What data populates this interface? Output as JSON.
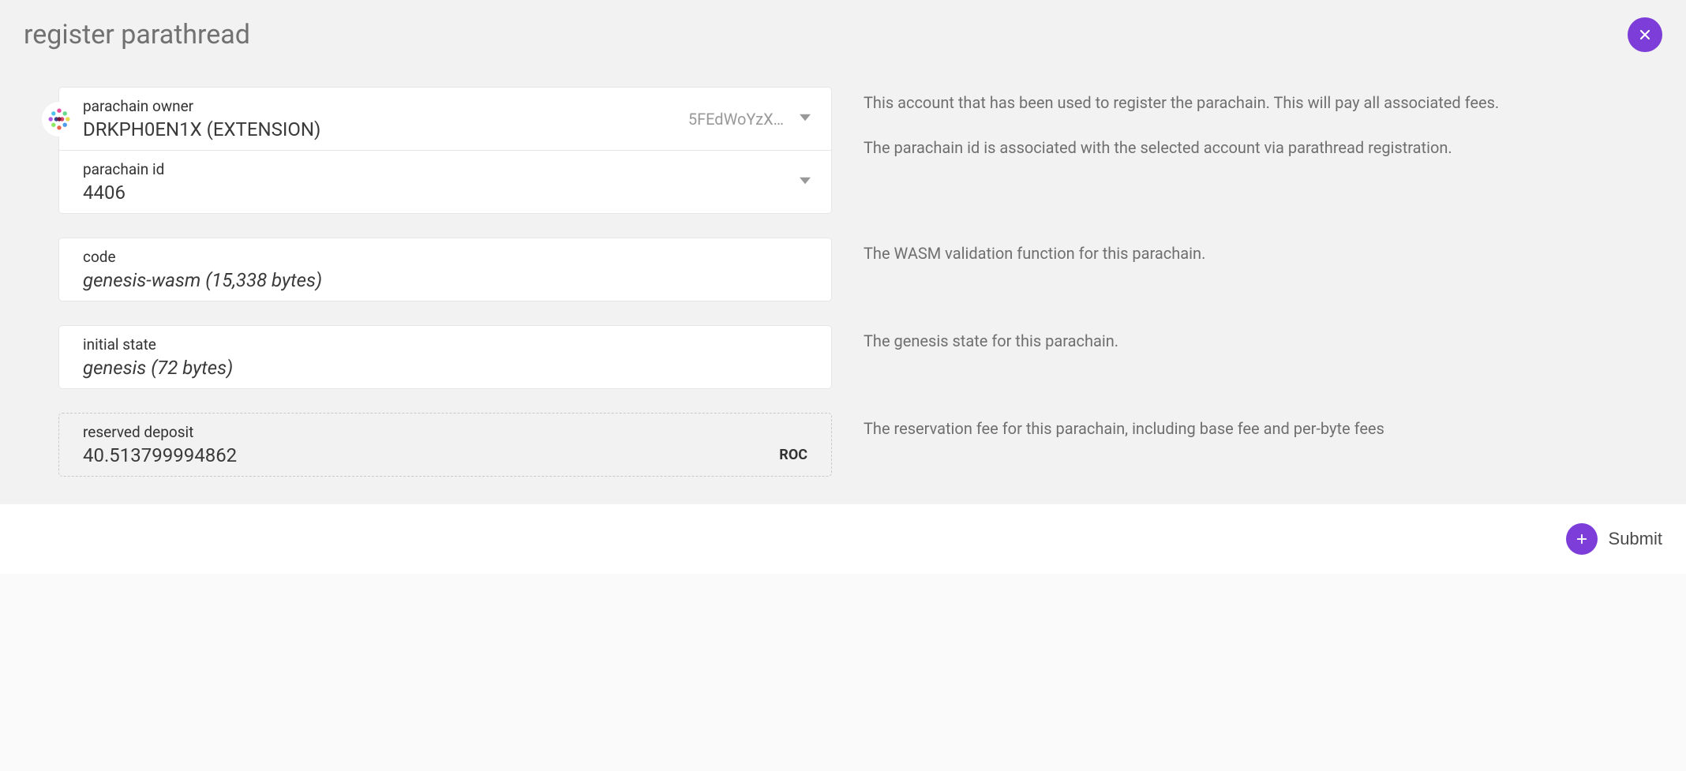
{
  "title": "register parathread",
  "owner": {
    "label": "parachain owner",
    "value": "DRKPH0EN1X (EXTENSION)",
    "address_short": "5FEdWoYzX…",
    "help": "This account that has been used to register the parachain. This will pay all associated fees."
  },
  "parachain_id": {
    "label": "parachain id",
    "value": "4406",
    "help": "The parachain id is associated with the selected account via parathread registration."
  },
  "code": {
    "label": "code",
    "value": "genesis-wasm (15,338 bytes)",
    "help": "The WASM validation function for this parachain."
  },
  "initial_state": {
    "label": "initial state",
    "value": "genesis (72 bytes)",
    "help": "The genesis state for this parachain."
  },
  "deposit": {
    "label": "reserved deposit",
    "value": "40.513799994862",
    "unit": "ROC",
    "help": "The reservation fee for this parachain, including base fee and per-byte fees"
  },
  "submit_label": "Submit"
}
